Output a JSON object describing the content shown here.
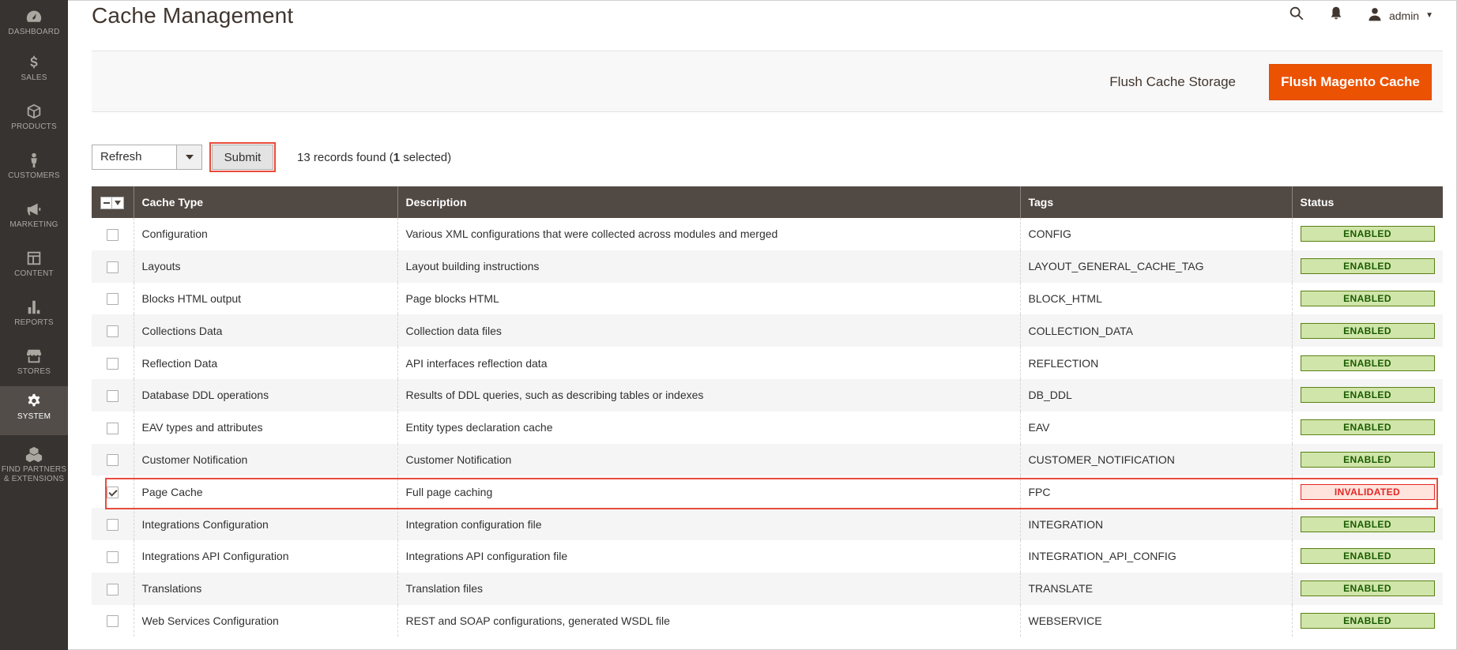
{
  "sidebar": {
    "items": [
      {
        "label": "DASHBOARD",
        "icon": "dashboard-icon"
      },
      {
        "label": "SALES",
        "icon": "dollar-icon"
      },
      {
        "label": "PRODUCTS",
        "icon": "cube-icon"
      },
      {
        "label": "CUSTOMERS",
        "icon": "person-icon"
      },
      {
        "label": "MARKETING",
        "icon": "megaphone-icon"
      },
      {
        "label": "CONTENT",
        "icon": "layout-icon"
      },
      {
        "label": "REPORTS",
        "icon": "bar-chart-icon"
      },
      {
        "label": "STORES",
        "icon": "store-icon"
      },
      {
        "label": "SYSTEM",
        "icon": "gear-icon",
        "active": true
      },
      {
        "label": "FIND PARTNERS & EXTENSIONS",
        "icon": "boxes-icon"
      }
    ]
  },
  "header": {
    "title": "Cache Management",
    "user": "admin"
  },
  "actions": {
    "flush_storage": "Flush Cache Storage",
    "flush_magento": "Flush Magento Cache"
  },
  "toolbar": {
    "mass_action_value": "Refresh",
    "submit_label": "Submit",
    "records_count": "13",
    "records_text_1": " records found (",
    "selected_count": "1",
    "records_text_2": " selected)"
  },
  "grid": {
    "headers": {
      "cache_type": "Cache Type",
      "description": "Description",
      "tags": "Tags",
      "status": "Status"
    },
    "rows": [
      {
        "checked": false,
        "type": "Configuration",
        "description": "Various XML configurations that were collected across modules and merged",
        "tags": "CONFIG",
        "status": "ENABLED"
      },
      {
        "checked": false,
        "type": "Layouts",
        "description": "Layout building instructions",
        "tags": "LAYOUT_GENERAL_CACHE_TAG",
        "status": "ENABLED"
      },
      {
        "checked": false,
        "type": "Blocks HTML output",
        "description": "Page blocks HTML",
        "tags": "BLOCK_HTML",
        "status": "ENABLED"
      },
      {
        "checked": false,
        "type": "Collections Data",
        "description": "Collection data files",
        "tags": "COLLECTION_DATA",
        "status": "ENABLED"
      },
      {
        "checked": false,
        "type": "Reflection Data",
        "description": "API interfaces reflection data",
        "tags": "REFLECTION",
        "status": "ENABLED"
      },
      {
        "checked": false,
        "type": "Database DDL operations",
        "description": "Results of DDL queries, such as describing tables or indexes",
        "tags": "DB_DDL",
        "status": "ENABLED"
      },
      {
        "checked": false,
        "type": "EAV types and attributes",
        "description": "Entity types declaration cache",
        "tags": "EAV",
        "status": "ENABLED"
      },
      {
        "checked": false,
        "type": "Customer Notification",
        "description": "Customer Notification",
        "tags": "CUSTOMER_NOTIFICATION",
        "status": "ENABLED"
      },
      {
        "checked": true,
        "type": "Page Cache",
        "description": "Full page caching",
        "tags": "FPC",
        "status": "INVALIDATED"
      },
      {
        "checked": false,
        "type": "Integrations Configuration",
        "description": "Integration configuration file",
        "tags": "INTEGRATION",
        "status": "ENABLED"
      },
      {
        "checked": false,
        "type": "Integrations API Configuration",
        "description": "Integrations API configuration file",
        "tags": "INTEGRATION_API_CONFIG",
        "status": "ENABLED"
      },
      {
        "checked": false,
        "type": "Translations",
        "description": "Translation files",
        "tags": "TRANSLATE",
        "status": "ENABLED"
      },
      {
        "checked": false,
        "type": "Web Services Configuration",
        "description": "REST and SOAP configurations, generated WSDL file",
        "tags": "WEBSERVICE",
        "status": "ENABLED"
      }
    ]
  },
  "colors": {
    "sidebar_bg": "#373330",
    "accent": "#eb5202",
    "grid_header": "#514943",
    "enabled_bg": "#d0e5a9",
    "invalidated": "#e22626",
    "highlight": "#e74c3c"
  }
}
